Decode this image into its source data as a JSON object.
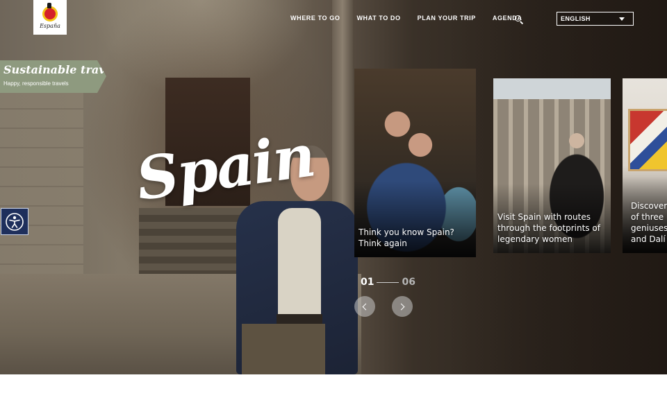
{
  "brand": {
    "logo_text": "España"
  },
  "nav": {
    "items": [
      "WHERE TO GO",
      "WHAT TO DO",
      "PLAN YOUR TRIP",
      "AGENDA"
    ],
    "search_icon": "search-icon"
  },
  "language": {
    "selected": "ENGLISH"
  },
  "sustainable": {
    "title": "Sustainable travel",
    "subtitle": "Happy, responsible travels"
  },
  "accessibility": {
    "icon": "accessibility-icon"
  },
  "hero": {
    "title": "Spain"
  },
  "cards": [
    {
      "text": "Think you know Spain? Think again"
    },
    {
      "text": "Visit Spain with routes through the footprints of legendary women"
    },
    {
      "text": "Discover\nof three\ngeniuses\nand Dalí"
    }
  ],
  "pager": {
    "current": "01",
    "total": "06"
  },
  "controls": {
    "prev_icon": "chevron-left-icon",
    "next_icon": "chevron-right-icon"
  },
  "colors": {
    "tag_green": "#8e9a7f",
    "access_blue": "#1e2f5c"
  }
}
